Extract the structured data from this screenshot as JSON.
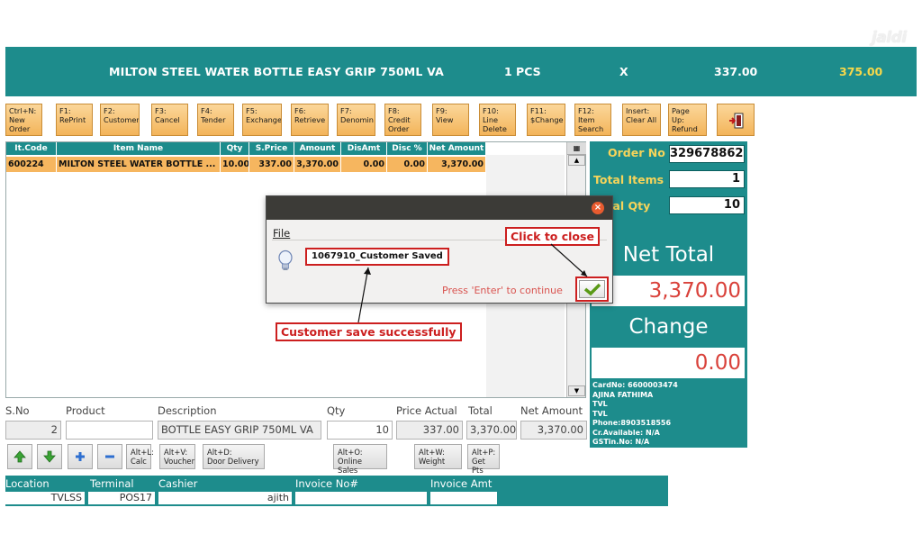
{
  "logo": "jaldi",
  "header": {
    "item_name": "MILTON STEEL WATER BOTTLE  EASY GRIP 750ML VA",
    "qty": "1 PCS",
    "times": "X",
    "price": "337.00",
    "total": "375.00"
  },
  "toolbar": [
    {
      "label": "Ctrl+N:\nNew\nOrder"
    },
    {
      "label": "F1:\nRePrint"
    },
    {
      "label": "F2:\nCustomer"
    },
    {
      "label": "F3:\nCancel"
    },
    {
      "label": "F4:\nTender"
    },
    {
      "label": "F5:\nExchange"
    },
    {
      "label": "F6:\nRetrieve"
    },
    {
      "label": "F7:\nDenomin"
    },
    {
      "label": "F8:\nCredit\nOrder"
    },
    {
      "label": "F9:\nView"
    },
    {
      "label": "F10:\nLine\nDelete"
    },
    {
      "label": "F11:\n$Change"
    },
    {
      "label": "F12:\nItem\nSearch"
    },
    {
      "label": "Insert:\nClear All"
    },
    {
      "label": "Page Up:\nRefund"
    }
  ],
  "toolbar_exit_icon": "exit-door-icon",
  "grid": {
    "columns": [
      "It.Code",
      "Item Name",
      "Qty",
      "S.Price",
      "Amount",
      "DisAmt",
      "Disc %",
      "Net Amount"
    ],
    "rows": [
      [
        "600224",
        "MILTON STEEL WATER BOTTLE ...",
        "10.00",
        "337.00",
        "3,370.00",
        "0.00",
        "0.00",
        "3,370.00"
      ]
    ]
  },
  "summary": {
    "order_no_label": "Order No",
    "order_no": "329678862",
    "total_items_label": "Total Items",
    "total_items": "1",
    "total_qty_label": "Total Qty",
    "total_qty": "10",
    "net_total_label": "Net Total",
    "net_total": "3,370.00",
    "change_label": "Change",
    "change": "0.00"
  },
  "customer": {
    "card_no": "CardNo: 6600003474",
    "name": "AJINA FATHIMA",
    "line1": "TVL",
    "line2": "TVL",
    "phone": "Phone:8903518556",
    "credit": "Cr.Available: N/A",
    "gstin": "GSTin.No: N/A"
  },
  "entry": {
    "sno_label": "S.No",
    "product_label": "Product",
    "description_label": "Description",
    "qty_label": "Qty",
    "price_label": "Price Actual",
    "total_label": "Total",
    "net_label": "Net Amount",
    "sno": "2",
    "product": "",
    "description": "BOTTLE  EASY GRIP 750ML VA",
    "qty": "10",
    "price": "337.00",
    "total": "3,370.00",
    "net": "3,370.00"
  },
  "action_buttons": {
    "calc": "Alt+L:\nCalc",
    "voucher": "Alt+V:\nVoucher",
    "door": "Alt+D:\nDoor Delivery",
    "online": "Alt+O:\nOnline Sales",
    "weight": "Alt+W:\nWeight",
    "getpts": "Alt+P:\nGet Pts"
  },
  "footer": {
    "location_label": "Location",
    "terminal_label": "Terminal",
    "cashier_label": "Cashier",
    "invoice_no_label": "Invoice No#",
    "invoice_amt_label": "Invoice Amt",
    "location": "TVLSS",
    "terminal": "POS17",
    "cashier": "ajith",
    "invoice_no": "",
    "invoice_amt": ""
  },
  "dialog": {
    "menu_file": "File",
    "message": "1067910_Customer Saved",
    "hint": "Press 'Enter' to continue"
  },
  "callouts": {
    "close": "Click to close",
    "saved": "Customer save successfully"
  },
  "colors": {
    "teal": "#1d8c8c",
    "orange": "#f6b65f",
    "yellow": "#f6d45a",
    "red": "#cc1f1f"
  }
}
